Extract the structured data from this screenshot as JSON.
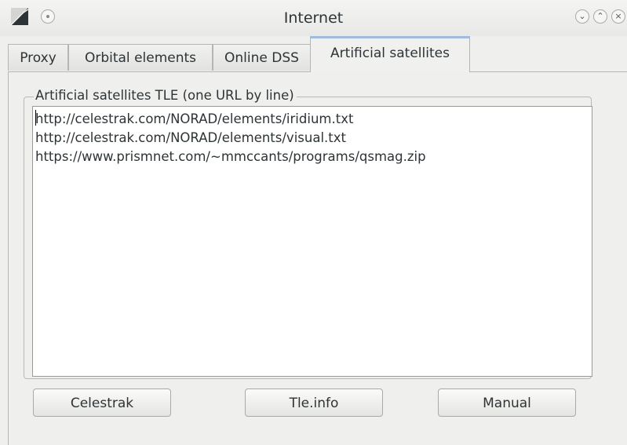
{
  "window": {
    "title": "Internet",
    "controls": {
      "minimize_icon": "chevron-down-icon",
      "maximize_icon": "chevron-up-icon",
      "close_icon": "close-icon"
    }
  },
  "tabs": [
    {
      "label": "Proxy",
      "active": false
    },
    {
      "label": "Orbital elements",
      "active": false
    },
    {
      "label": "Online DSS",
      "active": false
    },
    {
      "label": "Artificial satellites",
      "active": true
    }
  ],
  "satellites": {
    "group_title": "Artificial satellites TLE (one URL by line)",
    "urls": [
      "http://celestrak.com/NORAD/elements/iridium.txt",
      "http://celestrak.com/NORAD/elements/visual.txt",
      "https://www.prismnet.com/~mmccants/programs/qsmag.zip"
    ],
    "buttons": {
      "celestrak": "Celestrak",
      "tleinfo": "Tle.info",
      "manual": "Manual"
    }
  },
  "colors": {
    "active_tab_accent": "#6f9fd8",
    "background": "#efefed"
  }
}
